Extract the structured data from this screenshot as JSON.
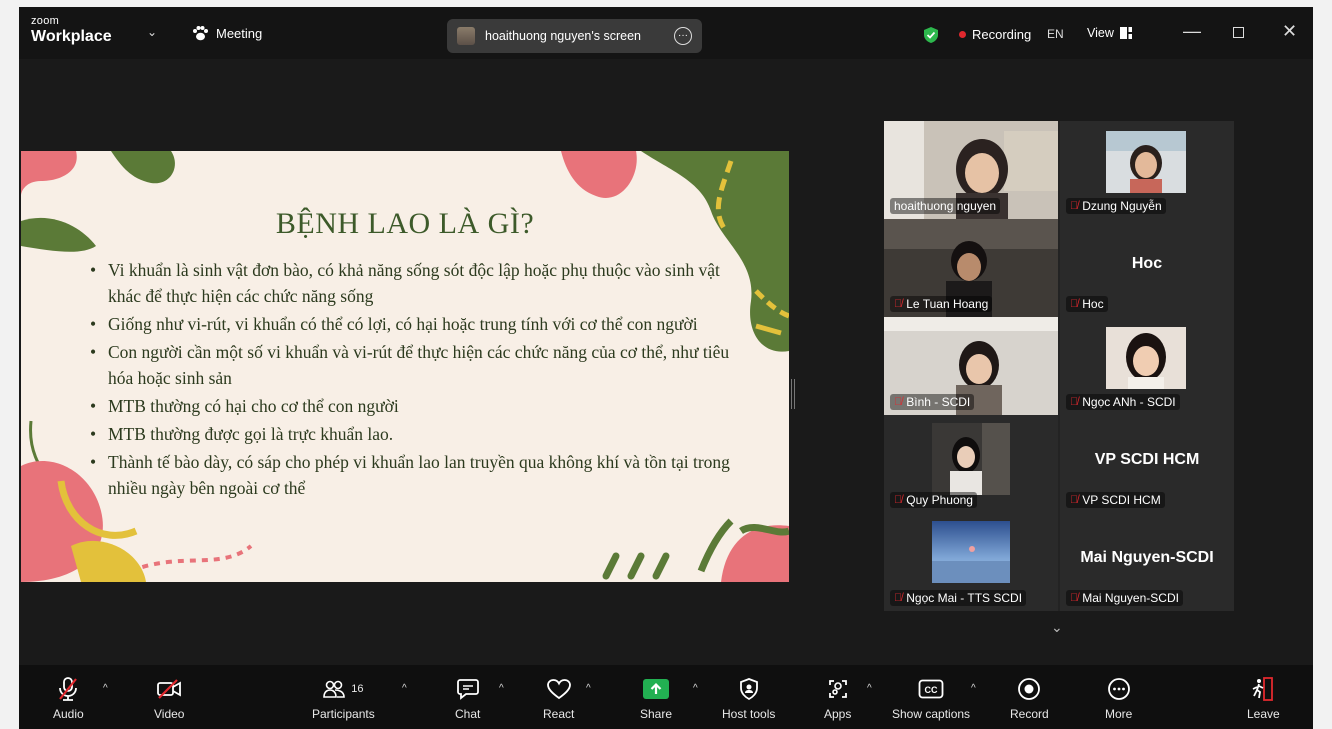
{
  "titlebar": {
    "brand_small": "zoom",
    "brand": "Workplace",
    "meeting_label": "Meeting",
    "screen_share_label": "hoaithuong nguyen's screen",
    "recording_label": "Recording",
    "language": "EN",
    "view_label": "View"
  },
  "slide": {
    "title": "BỆNH LAO LÀ GÌ?",
    "bullets": [
      "Vi khuẩn là sinh vật đơn bào, có khả năng sống sót độc lập hoặc phụ thuộc vào sinh vật khác để thực hiện các chức năng sống",
      "Giống như vi-rút, vi khuẩn có thể có lợi, có hại hoặc trung tính với cơ thể con người",
      "Con người cần một số vi khuẩn và vi-rút để thực hiện các chức năng của cơ thể, như tiêu hóa hoặc sinh sản",
      "MTB thường có hại cho cơ thể con người",
      "MTB thường được gọi là trực khuẩn lao.",
      "Thành tế bào dày, có sáp cho phép vi khuẩn lao lan truyền qua không khí và tồn tại trong nhiều ngày bên ngoài cơ thể"
    ]
  },
  "participants": [
    {
      "name": "hoaithuong nguyen",
      "video": true,
      "muted": false
    },
    {
      "name": "Dzung Nguyễn",
      "video": true,
      "muted": true
    },
    {
      "name": "Le Tuan Hoang",
      "video": true,
      "muted": true
    },
    {
      "name": "Hoc",
      "display": "Hoc",
      "video": false,
      "muted": true
    },
    {
      "name": "Bình - SCDI",
      "video": true,
      "muted": true
    },
    {
      "name": "Ngọc ANh - SCDI",
      "video": true,
      "muted": true
    },
    {
      "name": "Quy Phuong",
      "video": true,
      "muted": true
    },
    {
      "name": "VP SCDI HCM",
      "display": "VP SCDI HCM",
      "video": false,
      "muted": true
    },
    {
      "name": "Ngọc Mai - TTS SCDI",
      "video": true,
      "muted": true
    },
    {
      "name": "Mai Nguyen-SCDI",
      "display": "Mai Nguyen-SCDI",
      "video": false,
      "muted": true
    }
  ],
  "toolbar": {
    "audio": "Audio",
    "video": "Video",
    "participants": "Participants",
    "participant_count": "16",
    "chat": "Chat",
    "react": "React",
    "share": "Share",
    "host_tools": "Host tools",
    "apps": "Apps",
    "captions": "Show captions",
    "record": "Record",
    "more": "More",
    "leave": "Leave"
  },
  "colors": {
    "active_speaker": "#34c28b",
    "share_green": "#22b052",
    "recording_red": "#e0282e",
    "leave_red": "#e0282e"
  }
}
